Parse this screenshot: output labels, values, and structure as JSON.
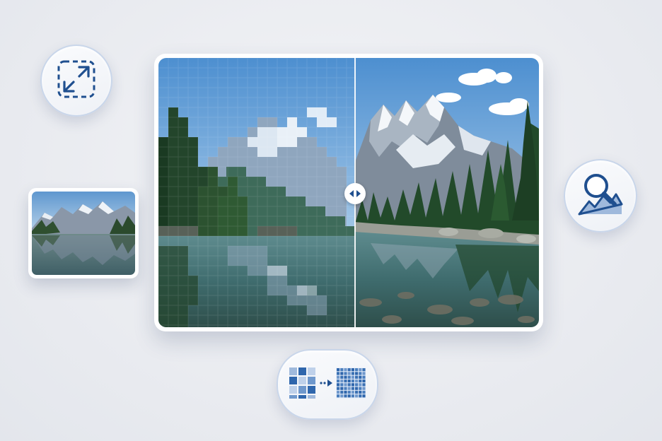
{
  "controls": {
    "resize_icon": "expand-arrows-icon",
    "zoom_icon": "magnifier-landscape-icon",
    "upscale_icon": "pixels-to-grid-icon",
    "compare_handle_icon": "split-arrows-icon"
  },
  "colors": {
    "accent": "#1f4f8f",
    "icon_light": "#9fb9dc",
    "card_border": "#c9d6ea",
    "background": "#eceef2"
  },
  "comparison": {
    "left_state": "pixelated",
    "right_state": "enhanced",
    "split_position": 0.5
  }
}
